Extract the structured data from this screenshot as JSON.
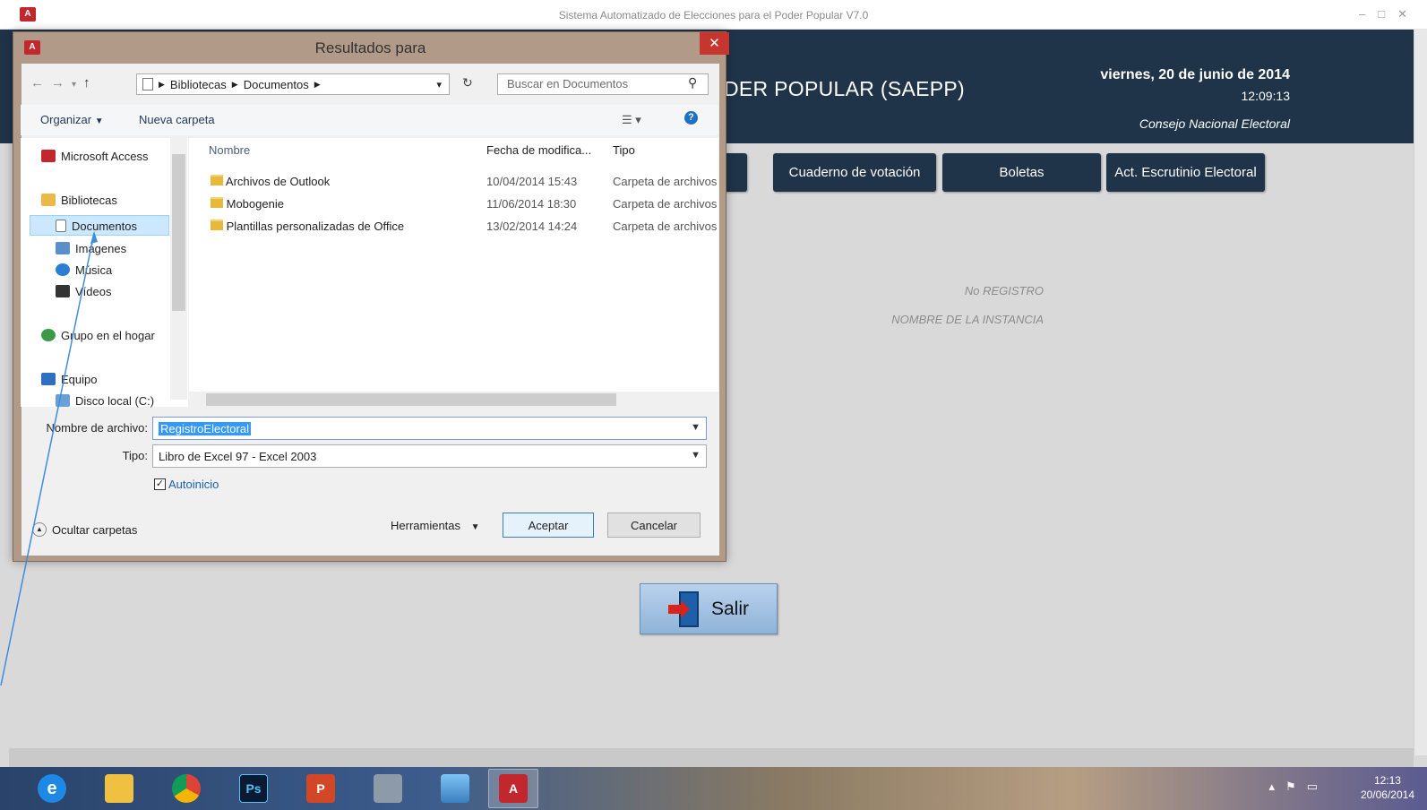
{
  "window": {
    "title": "Sistema Automatizado de Elecciones  para el Poder Popular V7.0",
    "app_icon": "access-icon"
  },
  "header": {
    "title": "DER POPULAR (SAEPP)",
    "date": "viernes, 20 de junio de 2014",
    "time": "12:09:13",
    "org": "Consejo Nacional Electoral"
  },
  "nav": {
    "items": [
      "Cuaderno de votación",
      "Boletas",
      "Act. Escrutinio Electoral"
    ]
  },
  "info": {
    "registro": "No REGISTRO",
    "instancia": "NOMBRE DE LA INSTANCIA"
  },
  "salir": {
    "label": "Salir"
  },
  "dialog": {
    "title": "Resultados para",
    "close": "✕",
    "address": {
      "parts": [
        "Bibliotecas",
        "Documentos"
      ]
    },
    "search": {
      "placeholder": "Buscar en Documentos"
    },
    "toolbar": {
      "organize": "Organizar",
      "new_folder": "Nueva carpeta"
    },
    "nav_pane": {
      "items": [
        {
          "label": "Microsoft Access",
          "icon": "access-icon"
        },
        {
          "label": "Bibliotecas",
          "icon": "library-icon"
        },
        {
          "label": "Documentos",
          "icon": "document-icon",
          "selected": true
        },
        {
          "label": "Imágenes",
          "icon": "image-icon"
        },
        {
          "label": "Música",
          "icon": "music-icon"
        },
        {
          "label": "Vídeos",
          "icon": "video-icon"
        },
        {
          "label": "Grupo en el hogar",
          "icon": "homegroup-icon"
        },
        {
          "label": "Equipo",
          "icon": "computer-icon"
        },
        {
          "label": "Disco local (C:)",
          "icon": "disk-icon"
        }
      ]
    },
    "columns": {
      "name": "Nombre",
      "date": "Fecha de modifica...",
      "type": "Tipo"
    },
    "files": [
      {
        "name": "Archivos de Outlook",
        "date": "10/04/2014 15:43",
        "type": "Carpeta de archivos"
      },
      {
        "name": "Mobogenie",
        "date": "11/06/2014 18:30",
        "type": "Carpeta de archivos"
      },
      {
        "name": "Plantillas personalizadas de Office",
        "date": "13/02/2014 14:24",
        "type": "Carpeta de archivos"
      }
    ],
    "filename": {
      "label": "Nombre de archivo:",
      "value": "RegistroElectoral"
    },
    "filetype": {
      "label": "Tipo:",
      "value": "Libro de Excel 97 - Excel 2003"
    },
    "autostart": {
      "label": "Autoinicio",
      "checked": true
    },
    "hide_folders": "Ocultar carpetas",
    "tools": "Herramientas",
    "ok": "Aceptar",
    "cancel": "Cancelar"
  },
  "taskbar": {
    "apps": [
      "internet-explorer-icon",
      "file-explorer-icon",
      "chrome-icon",
      "photoshop-icon",
      "powerpoint-icon",
      "file-manager-icon",
      "image-viewer-icon",
      "access-icon"
    ],
    "ps_label": "Ps",
    "clock_time": "12:13",
    "clock_date": "20/06/2014"
  }
}
